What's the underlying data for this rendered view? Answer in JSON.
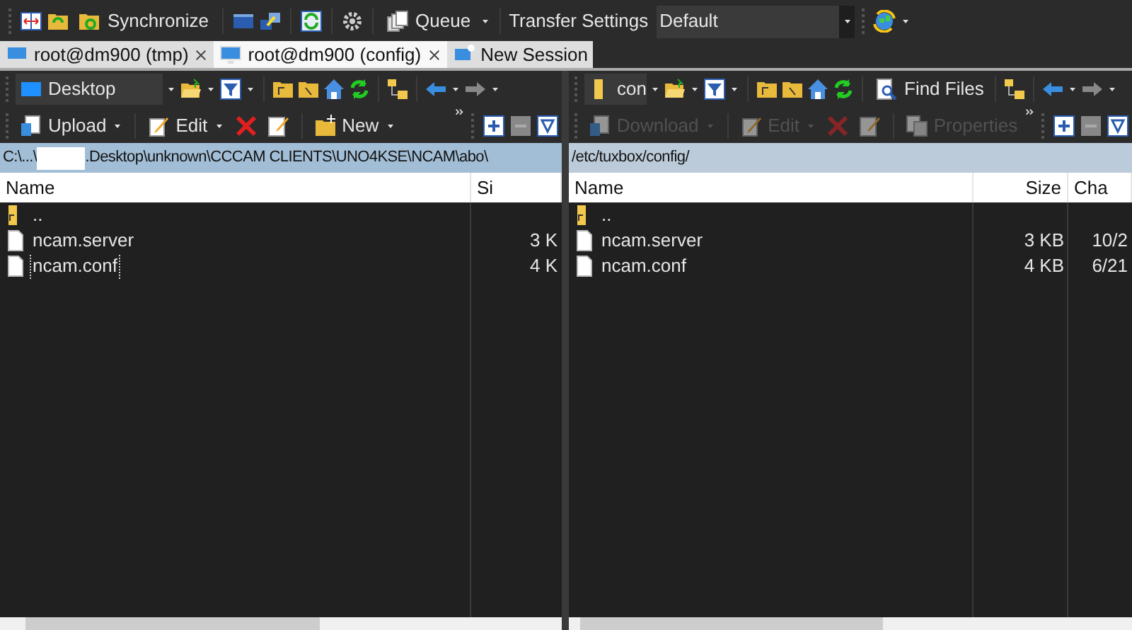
{
  "toolbar": {
    "synchronize": "Synchronize",
    "queue": "Queue",
    "transfer_settings": "Transfer Settings",
    "transfer_preset": "Default"
  },
  "tabs": [
    {
      "label": "root@dm900 (tmp)",
      "kind": "session",
      "selected": false
    },
    {
      "label": "root@dm900 (config)",
      "kind": "session",
      "selected": true
    },
    {
      "label": "New Session",
      "kind": "new",
      "selected": false
    }
  ],
  "panes": [
    {
      "location": "Desktop",
      "kind": "local",
      "active": true,
      "actions": [
        {
          "kind": "upload",
          "label": "Upload",
          "disabled": false
        },
        {
          "kind": "edit",
          "label": "Edit",
          "disabled": false
        },
        {
          "kind": "delete",
          "disabled": false
        },
        {
          "kind": "rename",
          "disabled": false
        },
        {
          "kind": "new",
          "label": "New",
          "disabled": false
        }
      ],
      "path": [
        "C:\\...\\",
        ".Desktop\\unknown\\CCCAM CLIENTS\\UNO4KSE\\NCAM\\abo\\"
      ],
      "columns": [
        "Name",
        "Si"
      ],
      "files": [
        {
          "kind": "parent",
          "cells": [
            ".."
          ],
          "focused": false
        },
        {
          "kind": "file",
          "cells": [
            "ncam.server",
            "3 K"
          ],
          "focused": false
        },
        {
          "kind": "file",
          "cells": [
            "ncam.conf",
            "4 K"
          ],
          "focused": true
        }
      ]
    },
    {
      "location": "con",
      "kind": "remote",
      "find_files": "Find Files",
      "active": false,
      "actions": [
        {
          "kind": "download",
          "label": "Download",
          "disabled": true
        },
        {
          "kind": "edit",
          "label": "Edit",
          "disabled": true
        },
        {
          "kind": "delete",
          "disabled": true
        },
        {
          "kind": "rename",
          "disabled": true
        },
        {
          "kind": "properties",
          "label": "Properties",
          "disabled": true
        }
      ],
      "path": [
        "/etc/tuxbox/config/"
      ],
      "columns": [
        "Name",
        "Size",
        "Cha"
      ],
      "files": [
        {
          "kind": "parent",
          "cells": [
            ".."
          ],
          "focused": false
        },
        {
          "kind": "file",
          "cells": [
            "ncam.server",
            "3 KB",
            "10/2"
          ],
          "focused": false
        },
        {
          "kind": "file",
          "cells": [
            "ncam.conf",
            "4 KB",
            "6/21"
          ],
          "focused": false
        }
      ]
    }
  ]
}
